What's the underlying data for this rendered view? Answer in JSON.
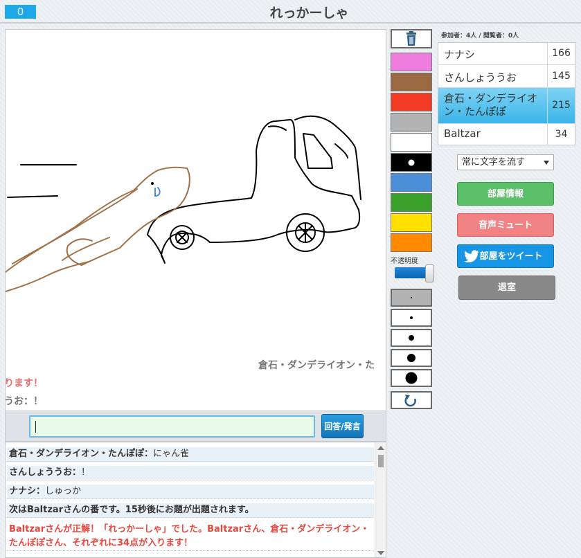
{
  "header": {
    "score": "0",
    "title": "れっかーしゃ"
  },
  "canvas": {
    "flow_texts": [
      "倉石・ダンデライオン・た",
      "ります！",
      "うお：！"
    ]
  },
  "answer": {
    "placeholder": "",
    "button_label": "回答/発言"
  },
  "log": [
    {
      "who": "倉石・ダンデライオン・たんぽぽ：",
      "text": "にゃん雀"
    },
    {
      "who": "さんしょううお：",
      "text": "！"
    },
    {
      "who": "ナナシ：",
      "text": "しゅっか"
    },
    {
      "who": "",
      "text": "次はBaltzarさんの番です。15秒後にお題が出題されます。"
    },
    {
      "who": "",
      "text": "Baltzarさんが正解！「れっかーしゃ」でした。Baltzarさん、倉石・ダンデライオン・たんぽぽさん、それぞれに34点が入ります！"
    }
  ],
  "tools": {
    "trash_icon": "trash-icon",
    "colors": [
      "#ee7ddd",
      "#9b6941",
      "#f23b25",
      "#b3b3b3",
      "#ffffff",
      "#000000",
      "#4b8fd8",
      "#3aa02b",
      "#ffe000",
      "#ff8a00"
    ],
    "opacity_label": "不透明度",
    "opacity": 0.8,
    "undo_icon": "undo-icon"
  },
  "room": {
    "participants_label": "参加者：4人 / 閲覧者：0人",
    "players": [
      {
        "name": "ナナシ",
        "score": "166",
        "active": false
      },
      {
        "name": "さんしょううお",
        "score": "145",
        "active": false
      },
      {
        "name": "倉石・ダンデライオン・たんぽぽ",
        "score": "215",
        "active": true
      },
      {
        "name": "Baltzar",
        "score": "34",
        "active": false
      }
    ],
    "scroll_option": "常に文字を流す",
    "buttons": {
      "info": "部屋情報",
      "mute": "音声ミュート",
      "tweet": "部屋をツイート",
      "exit": "退室"
    }
  }
}
